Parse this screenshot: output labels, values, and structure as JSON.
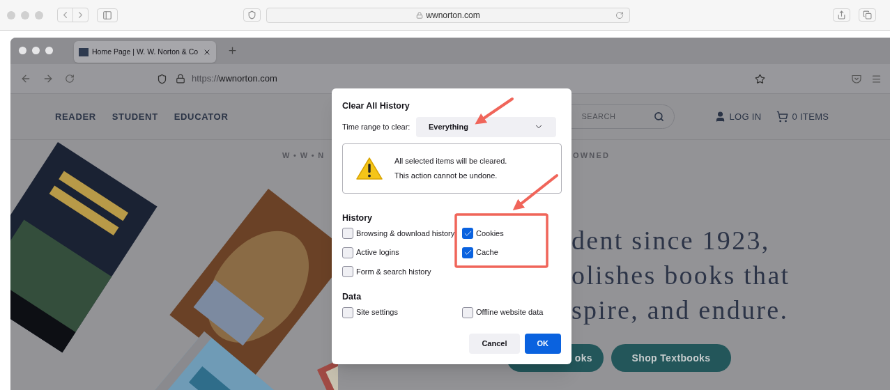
{
  "safari": {
    "address": "wwnorton.com"
  },
  "browser": {
    "tabs": [
      {
        "title": "Home Page | W. W. Norton & Co",
        "selected": true
      }
    ],
    "address_scheme": "https://",
    "address_host": "wwnorton.com"
  },
  "site": {
    "nav": [
      {
        "label": "READER"
      },
      {
        "label": "STUDENT"
      },
      {
        "label": "EDUCATOR"
      }
    ],
    "search": {
      "placeholder": "SEARCH"
    },
    "login": "LOG IN",
    "cart": "0 ITEMS",
    "tagline_left": "W • W • N",
    "tagline_right": "OWNED",
    "headline": [
      "dent since 1923,",
      "olishes books that",
      "spire, and endure."
    ],
    "buttons": [
      "oks",
      "Shop Textbooks"
    ]
  },
  "dialog": {
    "title": "Clear All History",
    "time_range_label": "Time range to clear:",
    "time_range": "Everything",
    "warning": [
      "All selected items will be cleared.",
      "This action cannot be undone."
    ],
    "sections": [
      {
        "title": "History",
        "items": [
          {
            "label": "Browsing & download history",
            "checked": false
          },
          {
            "label": "Cookies",
            "checked": true
          },
          {
            "label": "Active logins",
            "checked": false
          },
          {
            "label": "Cache",
            "checked": true
          },
          {
            "label": "Form & search history",
            "checked": false
          }
        ]
      },
      {
        "title": "Data",
        "items": [
          {
            "label": "Site settings",
            "checked": false
          },
          {
            "label": "Offline website data",
            "checked": false
          }
        ]
      }
    ],
    "buttons": [
      {
        "label": "Cancel",
        "kind": "secondary"
      },
      {
        "label": "OK",
        "kind": "primary"
      }
    ]
  }
}
